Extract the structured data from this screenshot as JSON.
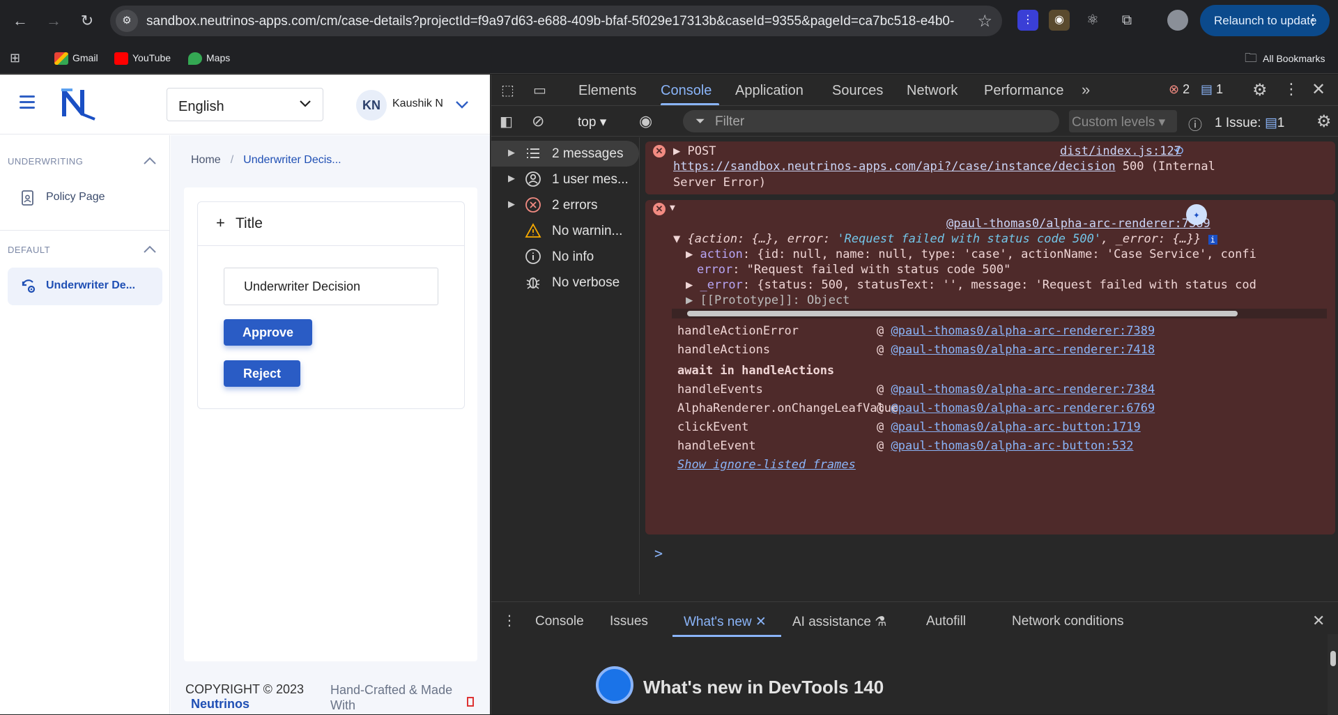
{
  "browser": {
    "url": "sandbox.neutrinos-apps.com/cm/case-details?projectId=f9a97d63-e688-409b-bfaf-5f029e17313b&caseId=9355&pageId=ca7bc518-e4b0-...",
    "relaunch_label": "Relaunch to update",
    "bookmarks": [
      "Gmail",
      "YouTube",
      "Maps"
    ],
    "all_bookmarks": "All Bookmarks"
  },
  "app": {
    "language": "English",
    "user_initials": "KN",
    "user_name": "Kaushik N",
    "sidebar": {
      "section1": "UNDERWRITING",
      "item1": "Policy Page",
      "section2": "DEFAULT",
      "item2": "Underwriter De..."
    },
    "breadcrumb": {
      "home": "Home",
      "separator": "/",
      "current": "Underwriter Decis..."
    },
    "card": {
      "plus": "+",
      "title": "Title",
      "input_value": "Underwriter Decision",
      "approve": "Approve",
      "reject": "Reject"
    },
    "footer": {
      "copyright": "COPYRIGHT © 2023",
      "brand": "Neutrinos",
      "handcrafted": "Hand-Crafted & Made With"
    }
  },
  "devtools": {
    "tabs": [
      "Elements",
      "Console",
      "Application",
      "Sources",
      "Network",
      "Performance"
    ],
    "error_count": "2",
    "message_count": "1",
    "context": "top",
    "filter_placeholder": "Filter",
    "levels": "Custom levels",
    "issues": "1 Issue:",
    "issues_count": "1",
    "sidebar": [
      {
        "label": "2 messages",
        "icon": "list-icon"
      },
      {
        "label": "1 user mes...",
        "icon": "user-icon"
      },
      {
        "label": "2 errors",
        "icon": "error-icon"
      },
      {
        "label": "No warnin...",
        "icon": "warning-icon"
      },
      {
        "label": "No info",
        "icon": "info-icon"
      },
      {
        "label": "No verbose",
        "icon": "bug-icon"
      }
    ],
    "error1": {
      "method": "POST",
      "source": "dist/index.js:127",
      "url": "https://sandbox.neutrinos-apps.com/api?/case/instance/decision",
      "status": "500 (Internal",
      "status2": "Server Error)"
    },
    "error2": {
      "source": "@paul-thomas0/alpha-arc-renderer:7389",
      "summary_a": "{action: {…}, error: ",
      "summary_b": "'Request failed with status code 500'",
      "summary_c": ", _error: {…}}",
      "action_key": "action",
      "action_val": ": {id: null, name: null, type: 'case', actionName: 'Case Service', confi",
      "error_key": "error",
      "error_val": ": \"Request failed with status code 500\"",
      "_error_key": "_error",
      "_error_val": ": {status: 500, statusText: '', message: 'Request failed with status cod",
      "proto": "[[Prototype]]: Object",
      "stack": [
        {
          "fn": "handleActionError",
          "src": "@paul-thomas0/alpha-arc-renderer:7389"
        },
        {
          "fn": "handleActions",
          "src": "@paul-thomas0/alpha-arc-renderer:7418"
        },
        {
          "fn": "await in handleActions",
          "src": ""
        },
        {
          "fn": "handleEvents",
          "src": "@paul-thomas0/alpha-arc-renderer:7384"
        },
        {
          "fn": "AlphaRenderer.onChangeLeafValue",
          "src": "@paul-thomas0/alpha-arc-renderer:6769"
        },
        {
          "fn": "clickEvent",
          "src": "@paul-thomas0/alpha-arc-button:1719"
        },
        {
          "fn": "handleEvent",
          "src": "@paul-thomas0/alpha-arc-button:532"
        }
      ],
      "show_ignored": "Show ignore-listed frames"
    },
    "prompt": ">",
    "drawer_tabs": [
      "Console",
      "Issues",
      "What's new",
      "AI assistance",
      "Autofill",
      "Network conditions"
    ],
    "whats_new_title": "What's new in DevTools 140"
  }
}
